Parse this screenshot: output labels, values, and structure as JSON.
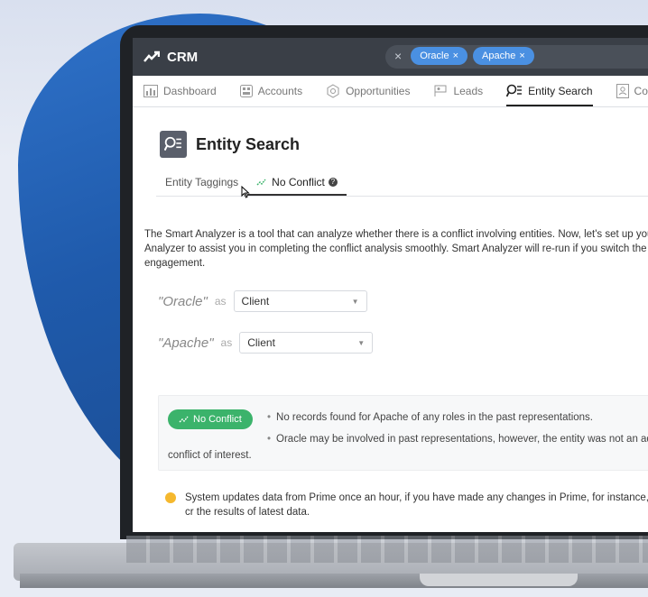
{
  "app": {
    "title": "CRM"
  },
  "search": {
    "chips": [
      {
        "label": "Oracle"
      },
      {
        "label": "Apache"
      }
    ]
  },
  "nav": {
    "items": [
      {
        "label": "Dashboard",
        "icon": "dashboard-icon"
      },
      {
        "label": "Accounts",
        "icon": "accounts-icon"
      },
      {
        "label": "Opportunities",
        "icon": "opportunities-icon"
      },
      {
        "label": "Leads",
        "icon": "leads-icon"
      },
      {
        "label": "Entity Search",
        "icon": "entity-search-icon",
        "active": true
      },
      {
        "label": "Con",
        "icon": "contacts-icon"
      }
    ]
  },
  "page": {
    "title": "Entity Search",
    "subtabs": [
      {
        "label": "Entity Taggings"
      },
      {
        "label": "No Conflict"
      }
    ],
    "description": "The Smart Analyzer is a tool that can analyze whether there is a conflict involving entities. Now, let's set up you Analyzer to assist you in completing the conflict analysis smoothly. Smart Analyzer will re-run if you switch the new engagement.",
    "roles": [
      {
        "entity": "\"Oracle\"",
        "as": "as",
        "value": "Client"
      },
      {
        "entity": "\"Apache\"",
        "as": "as",
        "value": "Client"
      }
    ],
    "result": {
      "badge": "No Conflict",
      "line1": "No records found for Apache of any roles in the past representations.",
      "line2": "Oracle may be involved in past representations, however, the entity was not an adve",
      "line3": "conflict of interest."
    },
    "notice": "System updates data from Prime once an hour, if you have made any changes in Prime, for instance, cr the results of latest data."
  },
  "colors": {
    "accent": "#4a90e2",
    "success": "#3bb36b",
    "warning": "#f5b82e",
    "titlebar": "#3a3f47"
  }
}
